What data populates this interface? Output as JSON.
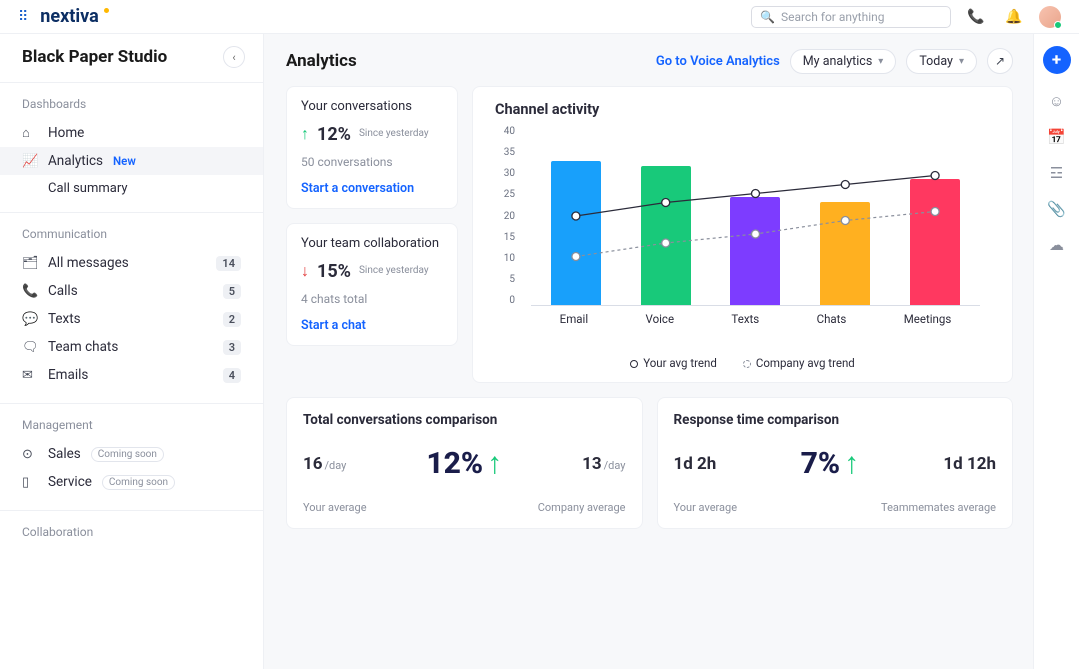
{
  "brand": "nextiva",
  "search_placeholder": "Search for anything",
  "workspace": "Black Paper Studio",
  "sidebar": {
    "dashboards_label": "Dashboards",
    "home": "Home",
    "analytics": "Analytics",
    "new_tag": "New",
    "call_summary": "Call summary",
    "communication_label": "Communication",
    "all_messages": "All messages",
    "all_messages_n": "14",
    "calls": "Calls",
    "calls_n": "5",
    "texts": "Texts",
    "texts_n": "2",
    "team_chats": "Team chats",
    "team_chats_n": "3",
    "emails": "Emails",
    "emails_n": "4",
    "management_label": "Management",
    "sales": "Sales",
    "service": "Service",
    "coming_soon": "Coming soon",
    "collaboration_label": "Collaboration"
  },
  "page": {
    "title": "Analytics",
    "voice_link": "Go to Voice Analytics",
    "my_analytics": "My analytics",
    "today": "Today"
  },
  "kpi_conv": {
    "title": "Your conversations",
    "pct": "12%",
    "since": "Since yesterday",
    "count": "50 conversations",
    "cta": "Start a conversation"
  },
  "kpi_team": {
    "title": "Your team collaboration",
    "pct": "15%",
    "since": "Since yesterday",
    "count": "4 chats total",
    "cta": "Start a chat"
  },
  "chart": {
    "title": "Channel activity",
    "legend_your": "Your avg trend",
    "legend_company": "Company avg trend"
  },
  "chart_data": {
    "type": "bar",
    "categories": [
      "Email",
      "Voice",
      "Texts",
      "Chats",
      "Meetings"
    ],
    "values": [
      32,
      31,
      24,
      23,
      28
    ],
    "series": [
      {
        "name": "Your avg trend",
        "values": [
          20,
          23,
          25,
          27,
          29
        ]
      },
      {
        "name": "Company avg trend",
        "values": [
          11,
          14,
          16,
          19,
          21
        ]
      }
    ],
    "bar_colors": [
      "#18a0fb",
      "#18c97a",
      "#7d3cff",
      "#ffb020",
      "#ff3860"
    ],
    "ylim": [
      0,
      40
    ],
    "yticks": [
      40,
      35,
      30,
      25,
      20,
      15,
      10,
      5,
      0
    ]
  },
  "comp_conv": {
    "title": "Total conversations comparison",
    "your_n": "16",
    "per": "/day",
    "pct": "12%",
    "other_n": "13",
    "your_label": "Your average",
    "other_label": "Company average"
  },
  "comp_resp": {
    "title": "Response time comparison",
    "your_n": "1d 2h",
    "pct": "7%",
    "other_n": "1d 12h",
    "your_label": "Your average",
    "other_label": "Teammemates average"
  }
}
